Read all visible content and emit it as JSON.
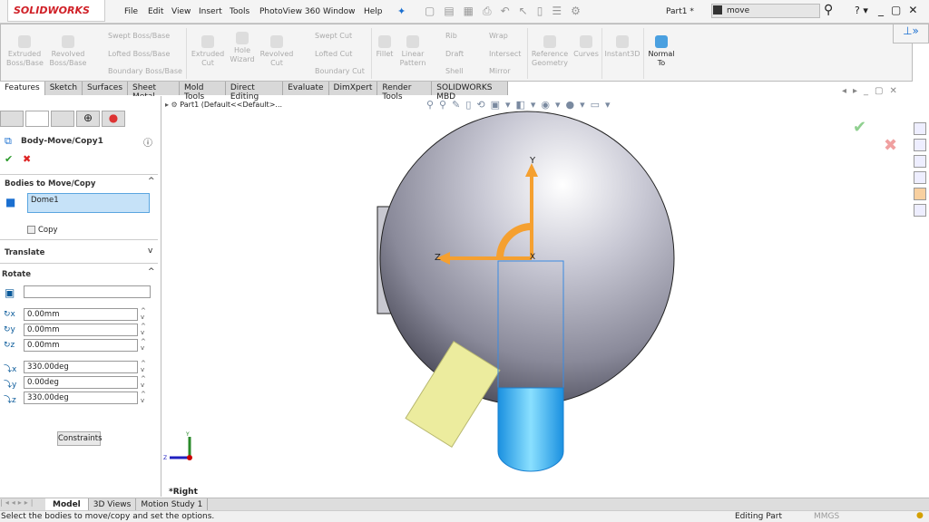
{
  "app": {
    "logo": "SOLIDWORKS",
    "doc_title": "Part1 *",
    "search_value": "move"
  },
  "menu": [
    "File",
    "Edit",
    "View",
    "Insert",
    "Tools",
    "PhotoView 360",
    "Window",
    "Help"
  ],
  "toolbar": {
    "big": [
      {
        "label": "Extruded Boss/Base"
      },
      {
        "label": "Revolved Boss/Base"
      },
      {
        "label": "Extruded Cut"
      },
      {
        "label": "Hole Wizard"
      },
      {
        "label": "Revolved Cut"
      },
      {
        "label": "Fillet"
      },
      {
        "label": "Linear Pattern"
      },
      {
        "label": "Reference Geometry"
      },
      {
        "label": "Curves"
      },
      {
        "label": "Instant3D"
      },
      {
        "label": "Normal To"
      }
    ],
    "small": [
      "Swept Boss/Base",
      "Lofted Boss/Base",
      "Boundary Boss/Base",
      "Swept Cut",
      "Lofted Cut",
      "Boundary Cut",
      "Rib",
      "Draft",
      "Shell",
      "Wrap",
      "Intersect",
      "Mirror"
    ]
  },
  "tabs": [
    "Features",
    "Sketch",
    "Surfaces",
    "Sheet Metal",
    "Mold Tools",
    "Direct Editing",
    "Evaluate",
    "DimXpert",
    "Render Tools",
    "SOLIDWORKS MBD"
  ],
  "tree": {
    "breadcrumb": "Part1  (Default<<Default>..."
  },
  "panel": {
    "title": "Body-Move/Copy1",
    "bodies_header": "Bodies to Move/Copy",
    "bodies_value": "Dome1",
    "copy_label": "Copy",
    "translate_header": "Translate",
    "rotate_header": "Rotate",
    "rotate_ref": "",
    "xyz": [
      "0.00mm",
      "0.00mm",
      "0.00mm"
    ],
    "angles": [
      "330.00deg",
      "0.00deg",
      "330.00deg"
    ],
    "constraints": "Constraints"
  },
  "viewport": {
    "view_label": "*Right",
    "triad": {
      "y": "Y",
      "z": "Z",
      "x": "X"
    }
  },
  "bottom_tabs": [
    "Model",
    "3D Views",
    "Motion Study 1"
  ],
  "status": {
    "message": "Select the bodies to move/copy and set the options.",
    "mode": "Editing Part",
    "units": "MMGS"
  },
  "colors": {
    "accent": "#d02027",
    "triad": "#f5a030",
    "selection": "#c6e2f8",
    "blue_body": "#38b8f0",
    "yellow_body": "#ecec9e"
  }
}
